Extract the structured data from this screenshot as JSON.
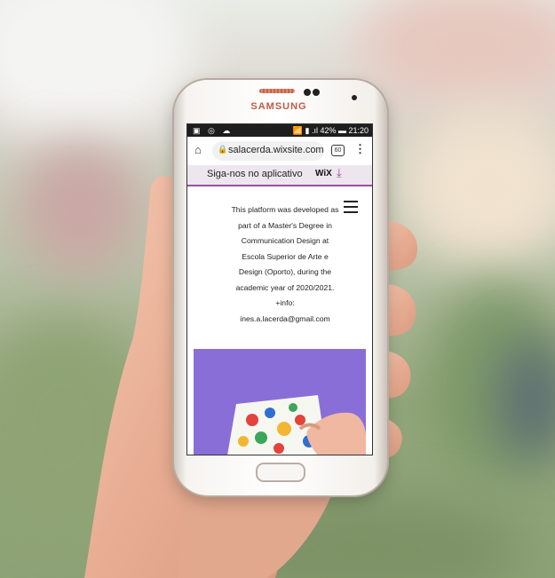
{
  "phone": {
    "brand": "SAMSUNG"
  },
  "statusbar": {
    "left_icons": "▣ ◎ ☁",
    "right_text": "📶 ▮ .ıl 42% ▬ 21:20"
  },
  "browser": {
    "url": "salacerda.wixsite.com",
    "tabs_count": "60",
    "home_icon": "home-icon",
    "lock_icon": "lock-icon",
    "menu_icon": "more-vert-icon"
  },
  "app_banner": {
    "text": "Siga-nos no aplicativo",
    "logo": "WiX",
    "icon": "download-icon"
  },
  "page": {
    "description": "This platform was developed as part of a Master's Degree in Communication Design at Escola Superior de Arte e Design (Oporto), during the academic year of 2020/2021. +info: ines.a.lacerda@gmail.com",
    "lines": [
      "This platform was developed as",
      "part of a Master's Degree in",
      "Communication Design at",
      "Escola Superior de Arte e",
      "Design (Oporto), during the",
      "academic year of 2020/2021.",
      "+info:",
      "ines.a.lacerda@gmail.com"
    ],
    "menu_icon": "hamburger-icon"
  },
  "colors": {
    "banner_accent": "#a04aa6",
    "art_background": "#8a6ed8"
  }
}
